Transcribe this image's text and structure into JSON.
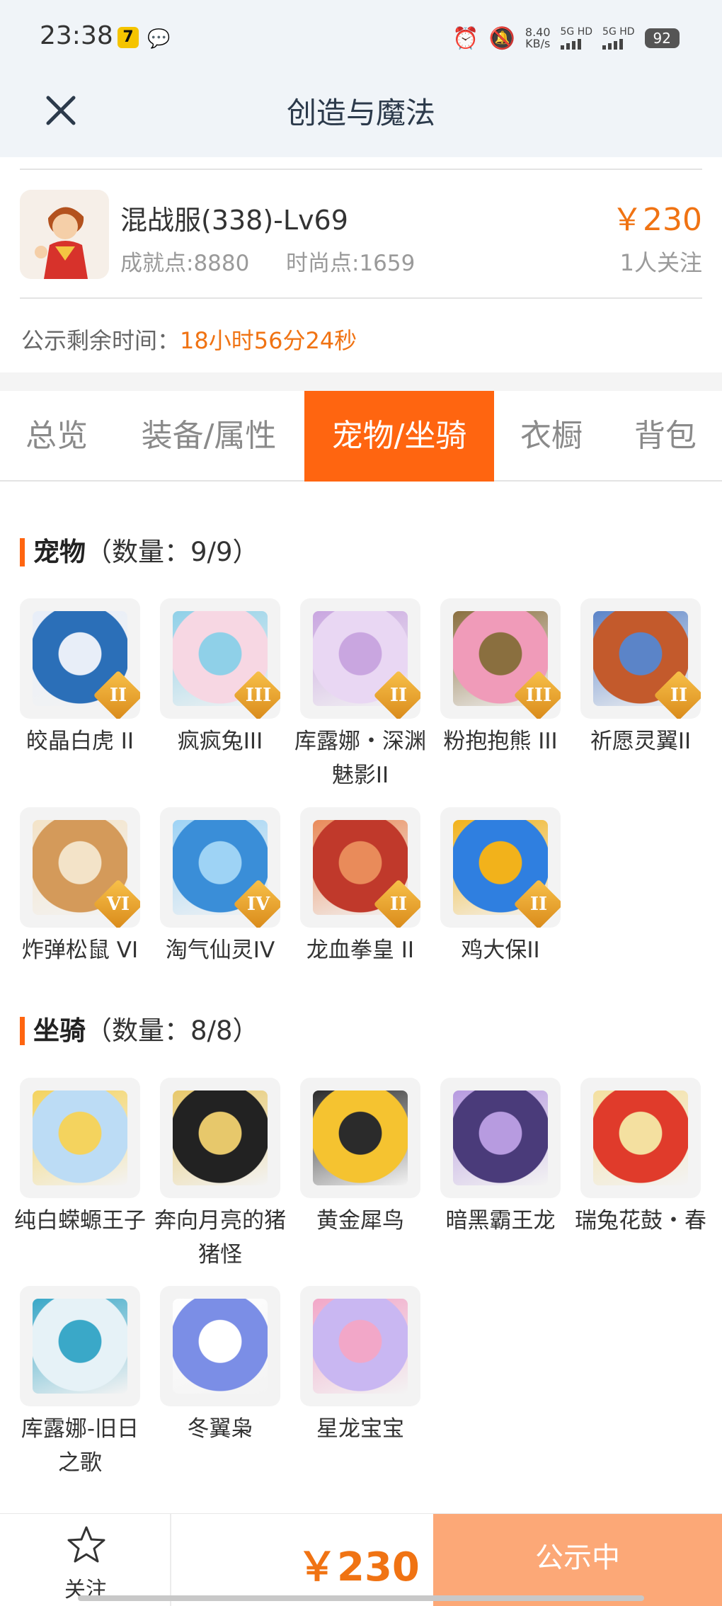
{
  "status_bar": {
    "time": "23:38",
    "app_icon": "7",
    "speed_value": "8.40",
    "speed_unit": "KB/s",
    "sim1": "5G HD",
    "sim2": "5G HD",
    "battery": "92"
  },
  "header": {
    "title": "创造与魔法"
  },
  "listing": {
    "name": "混战服(338)-Lv69",
    "achievement": "成就点:8880",
    "fashion": "时尚点:1659",
    "price": "￥230",
    "followers": "1人关注",
    "notice_label": "公示剩余时间：",
    "notice_time": "18小时56分24秒"
  },
  "tabs": [
    {
      "label": "总览"
    },
    {
      "label": "装备/属性"
    },
    {
      "label": "宠物/坐骑"
    },
    {
      "label": "衣橱"
    },
    {
      "label": "背包"
    }
  ],
  "active_tab": "宠物/坐骑",
  "pets": {
    "title": "宠物",
    "count": "（数量：9/9）",
    "items": [
      {
        "name": "皎晶白虎 II",
        "tier": "II",
        "icon": "white-tiger"
      },
      {
        "name": "疯疯兔III",
        "tier": "III",
        "icon": "crazy-rabbit"
      },
      {
        "name": "库露娜・深渊魅影II",
        "tier": "II",
        "icon": "kuluna-girl"
      },
      {
        "name": "粉抱抱熊 III",
        "tier": "III",
        "icon": "pink-bear"
      },
      {
        "name": "祈愿灵翼II",
        "tier": "II",
        "icon": "wish-bird"
      },
      {
        "name": "炸弹松鼠 VI",
        "tier": "VI",
        "icon": "bomb-squirrel"
      },
      {
        "name": "淘气仙灵IV",
        "tier": "IV",
        "icon": "naughty-fairy"
      },
      {
        "name": "龙血拳皇 II",
        "tier": "II",
        "icon": "dragon-boxer"
      },
      {
        "name": "鸡大保II",
        "tier": "II",
        "icon": "blue-chicken"
      }
    ]
  },
  "mounts": {
    "title": "坐骑",
    "count": "（数量：8/8）",
    "items": [
      {
        "name": "纯白蝾螈王子",
        "icon": "white-axolotl"
      },
      {
        "name": "奔向月亮的猪猪怪",
        "icon": "moon-pig"
      },
      {
        "name": "黄金犀鸟",
        "icon": "golden-hornbill"
      },
      {
        "name": "暗黑霸王龙",
        "icon": "dark-trex"
      },
      {
        "name": "瑞兔花鼓・春",
        "icon": "rabbit-drum"
      },
      {
        "name": "库露娜-旧日之歌",
        "icon": "kuluna-song"
      },
      {
        "name": "冬翼枭",
        "icon": "winter-owl"
      },
      {
        "name": "星龙宝宝",
        "icon": "star-dragon"
      }
    ]
  },
  "bottom_bar": {
    "follow_label": "关注",
    "price": "￥230",
    "status_button": "公示中"
  },
  "colors": {
    "accent": "#ff6510",
    "price": "#f07313",
    "button": "#fca877"
  }
}
